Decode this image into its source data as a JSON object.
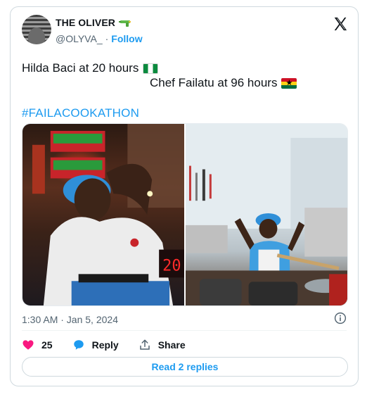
{
  "author": {
    "display_name": "THE OLIVER",
    "name_emoji_icon": "water-pistol-icon",
    "handle": "@OLYVA_",
    "separator": "·",
    "follow_label": "Follow"
  },
  "tweet": {
    "line1_text": "Hilda Baci at 20 hours",
    "line1_flag_icon": "nigeria-flag-icon",
    "line2_text": "Chef Failatu at 96 hours",
    "line2_flag_icon": "ghana-flag-icon",
    "hashtag": "#FAILACOOKATHON",
    "timestamp": "1:30 AM · Jan 5, 2024"
  },
  "media": {
    "left_photo_icon": "chef-exhausted-photo",
    "right_photo_icon": "chef-cheering-photo",
    "left_clock_digits": "20"
  },
  "engagement": {
    "likes_count": "25",
    "reply_label": "Reply",
    "share_label": "Share",
    "read_replies_label": "Read 2 replies"
  },
  "colors": {
    "accent": "#1d9bf0",
    "like": "#f91880",
    "text_primary": "#0f1419",
    "text_secondary": "#536471",
    "border": "#cfd9de"
  }
}
